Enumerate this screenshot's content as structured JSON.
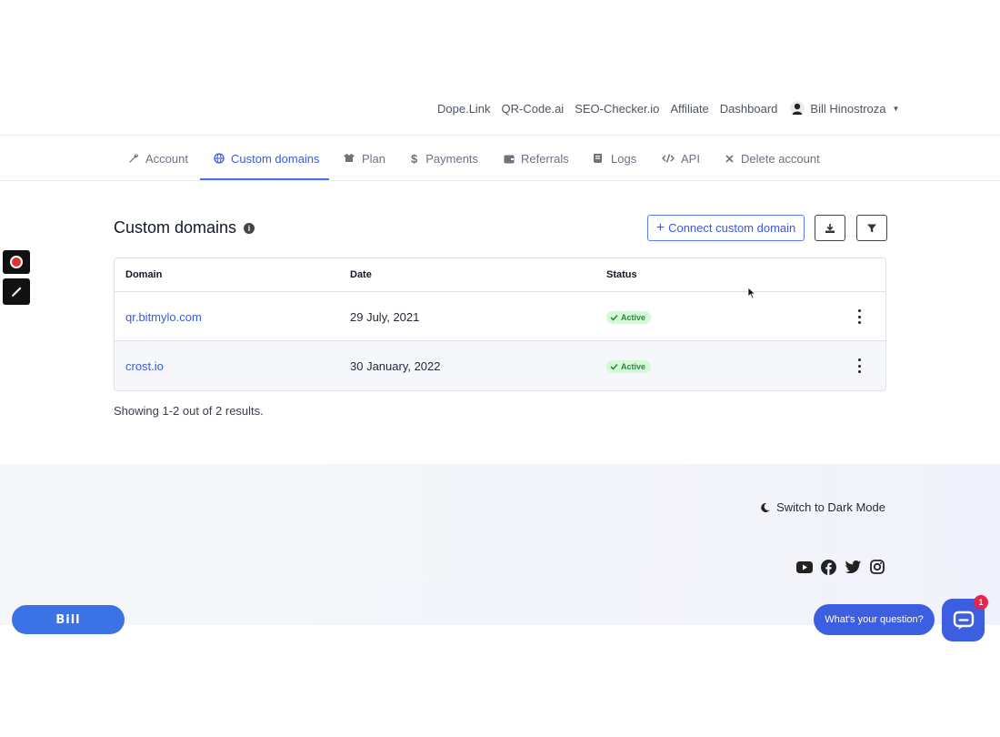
{
  "topnav": {
    "links": [
      "Dope.Link",
      "QR-Code.ai",
      "SEO-Checker.io",
      "Affiliate",
      "Dashboard"
    ],
    "user_name": "Bill Hinostroza"
  },
  "tabs": [
    {
      "label": "Account",
      "icon": "wrench-icon"
    },
    {
      "label": "Custom domains",
      "icon": "globe-icon",
      "active": true
    },
    {
      "label": "Plan",
      "icon": "box-icon"
    },
    {
      "label": "Payments",
      "icon": "dollar-icon"
    },
    {
      "label": "Referrals",
      "icon": "wallet-icon"
    },
    {
      "label": "Logs",
      "icon": "scroll-icon"
    },
    {
      "label": "API",
      "icon": "code-icon"
    },
    {
      "label": "Delete account",
      "icon": "close-icon"
    }
  ],
  "page": {
    "title": "Custom domains",
    "connect_label": "Connect custom domain"
  },
  "table": {
    "headers": {
      "domain": "Domain",
      "date": "Date",
      "status": "Status"
    },
    "rows": [
      {
        "domain": "qr.bitmylo.com",
        "date": "29 July, 2021",
        "status": "Active"
      },
      {
        "domain": "crost.io",
        "date": "30 January, 2022",
        "status": "Active"
      }
    ],
    "summary": "Showing 1-2 out of 2 results."
  },
  "footer": {
    "dark_mode": "Switch to Dark Mode",
    "socials": [
      "youtube-icon",
      "facebook-icon",
      "twitter-icon",
      "instagram-icon"
    ]
  },
  "overlay": {
    "bill_label": "Bill",
    "chat_prompt": "What's your question?",
    "chat_badge": "1"
  },
  "colors": {
    "accent": "#3b5bdb",
    "success_bg": "#d3f9d8",
    "success_text": "#2b8a3e",
    "chat": "#3c5ee0"
  }
}
